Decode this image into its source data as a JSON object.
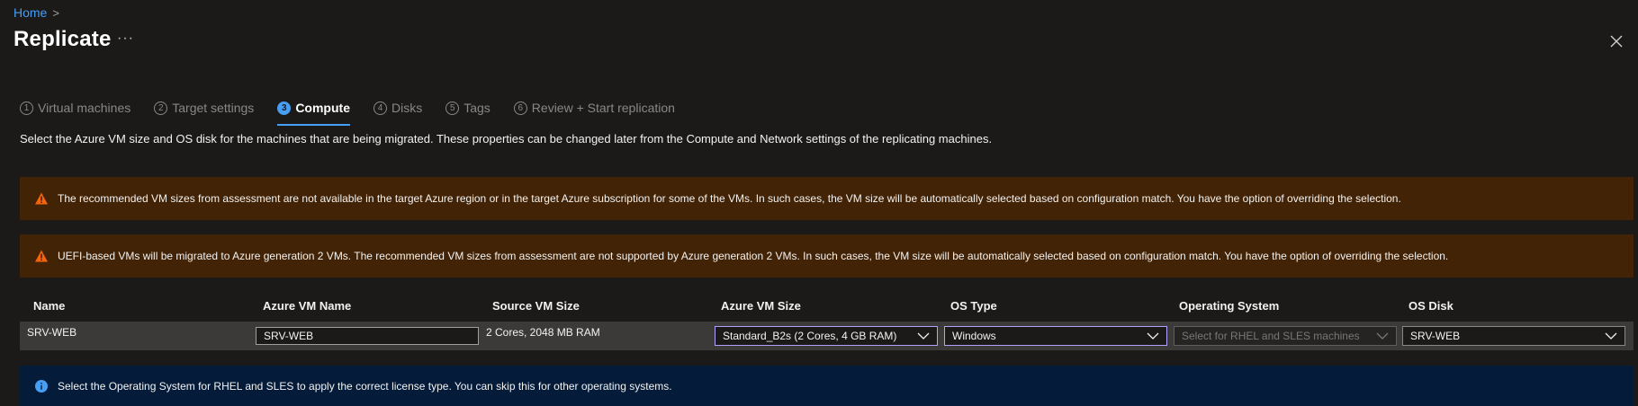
{
  "breadcrumb": {
    "home": "Home",
    "separator": ">"
  },
  "header": {
    "title": "Replicate",
    "more": "···"
  },
  "tabs": [
    {
      "num": "1",
      "label": "Virtual machines"
    },
    {
      "num": "2",
      "label": "Target settings"
    },
    {
      "num": "3",
      "label": "Compute"
    },
    {
      "num": "4",
      "label": "Disks"
    },
    {
      "num": "5",
      "label": "Tags"
    },
    {
      "num": "6",
      "label": "Review + Start replication"
    }
  ],
  "description": "Select the Azure VM size and OS disk for the machines that are being migrated. These properties can be changed later from the Compute and Network settings of the replicating machines.",
  "warnings": [
    "The recommended VM sizes from assessment are not available in the target Azure region or in the target Azure subscription for some of the VMs. In such cases, the VM size will be automatically selected based on configuration match. You have the option of overriding the selection.",
    "UEFI-based VMs will be migrated to Azure generation 2 VMs. The recommended VM sizes from assessment are not supported by Azure generation 2 VMs. In such cases, the VM size will be automatically selected based on configuration match. You have the option of overriding the selection."
  ],
  "table": {
    "columns": [
      "Name",
      "Azure VM Name",
      "Source VM Size",
      "Azure VM Size",
      "OS Type",
      "Operating System",
      "OS Disk"
    ],
    "rows": [
      {
        "name": "SRV-WEB",
        "azure_vm_name": "SRV-WEB",
        "source_vm_size": "2 Cores, 2048 MB RAM",
        "azure_vm_size": "Standard_B2s (2 Cores, 4 GB RAM)",
        "os_type": "Windows",
        "operating_system_placeholder": "Select for RHEL and SLES machines",
        "os_disk": "SRV-WEB"
      }
    ]
  },
  "info": "Select the Operating System for RHEL and SLES to apply the correct license type. You can skip this for other operating systems.",
  "colors": {
    "accent": "#479ef5",
    "warning_bg": "#422305",
    "info_bg": "#041c3a",
    "focus_border": "#b4a0ff"
  },
  "icons": [
    "chevron-right-icon",
    "close-icon",
    "warning-icon",
    "info-icon",
    "chevron-down-icon"
  ]
}
